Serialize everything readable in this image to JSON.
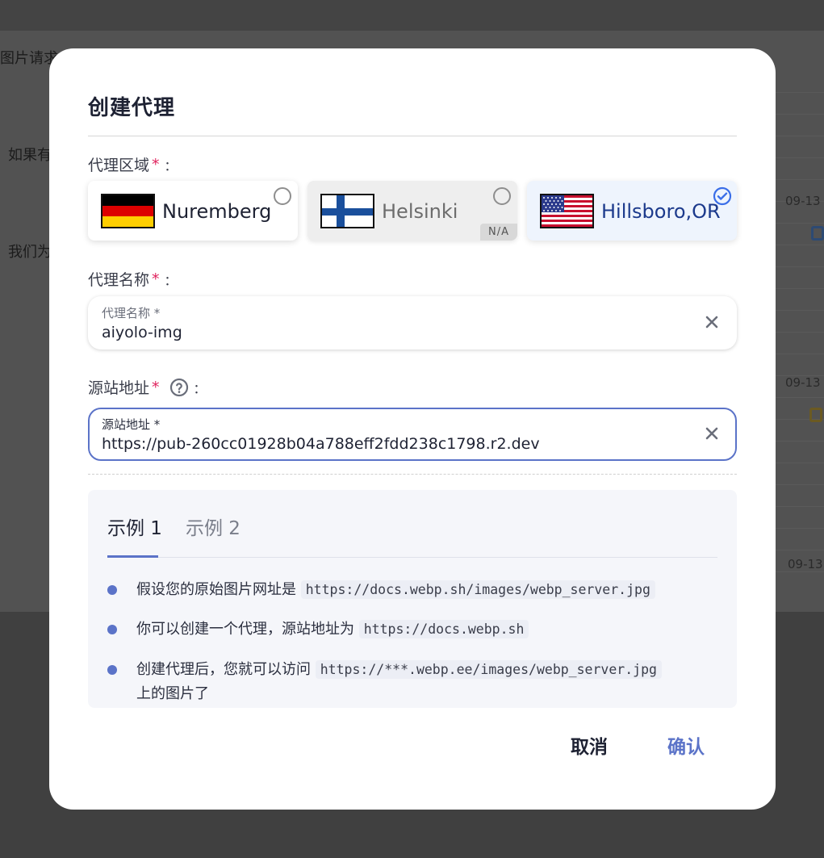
{
  "background": {
    "text_1": "图片请求",
    "text_2": "如果有",
    "text_3": "我们为",
    "date_1": "09-13",
    "date_2": "09-13",
    "date_3": "09-13"
  },
  "modal": {
    "title": "创建代理",
    "region_label": "代理区域",
    "required_mark": "*",
    "colon": "：",
    "regions": [
      {
        "name": "Nuremberg",
        "flag": "germany-flag-icon",
        "status": "available",
        "selected": false
      },
      {
        "name": "Helsinki",
        "flag": "finland-flag-icon",
        "status": "disabled",
        "badge": "N/A",
        "selected": false
      },
      {
        "name": "Hillsboro,OR",
        "flag": "usa-flag-icon",
        "status": "available",
        "selected": true
      }
    ],
    "name_label": "代理名称",
    "name_input": {
      "floating_label": "代理名称 *",
      "value": "aiyolo-img"
    },
    "origin_label": "源站地址",
    "origin_input": {
      "floating_label": "源站地址 *",
      "value": "https://pub-260cc01928b04a788eff2fdd238c1798.r2.dev"
    },
    "example_tabs": [
      {
        "label": "示例 1",
        "active": true
      },
      {
        "label": "示例 2",
        "active": false
      }
    ],
    "examples": [
      {
        "text": "假设您的原始图片网址是",
        "code": "https://docs.webp.sh/images/webp_server.jpg",
        "suffix": ""
      },
      {
        "text": "你可以创建一个代理，源站地址为",
        "code": "https://docs.webp.sh",
        "suffix": ""
      },
      {
        "text": "创建代理后，您就可以访问",
        "code": "https://***.webp.ee/images/webp_server.jpg",
        "suffix": "上的图片了"
      }
    ],
    "cancel_label": "取消",
    "confirm_label": "确认"
  },
  "colors": {
    "accent": "#5b73c8",
    "required": "#e0245e",
    "selected_card_bg": "#eef4fd",
    "disabled_card_bg": "#eeeeee"
  }
}
